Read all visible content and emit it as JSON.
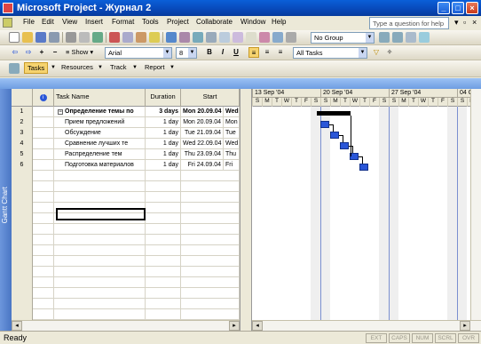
{
  "window": {
    "title": "Microsoft Project - Журнал 2"
  },
  "menu": {
    "items": [
      "File",
      "Edit",
      "View",
      "Insert",
      "Format",
      "Tools",
      "Project",
      "Collaborate",
      "Window",
      "Help"
    ],
    "help_placeholder": "Type a question for help"
  },
  "toolbar1": {
    "show_label": "Show",
    "group_value": "No Group"
  },
  "toolbar2": {
    "font": "Arial",
    "size": "8",
    "filter": "All Tasks",
    "bold": "B",
    "italic": "I",
    "underline": "U"
  },
  "guide": {
    "tasks": "Tasks",
    "resources": "Resources",
    "track": "Track",
    "report": "Report"
  },
  "sidebar": {
    "label": "Gantt Chart"
  },
  "table": {
    "headers": {
      "task_name": "Task Name",
      "duration": "Duration",
      "start": "Start"
    },
    "rows": [
      {
        "id": "1",
        "name": "Определение темы по",
        "duration": "3 days",
        "start": "Mon 20.09.04",
        "extra": "Wed",
        "bold": true
      },
      {
        "id": "2",
        "name": "Прием предложений",
        "duration": "1 day",
        "start": "Mon 20.09.04",
        "extra": "Mon"
      },
      {
        "id": "3",
        "name": "Обсуждение",
        "duration": "1 day",
        "start": "Tue 21.09.04",
        "extra": "Tue"
      },
      {
        "id": "4",
        "name": "Сравнение лучших те",
        "duration": "1 day",
        "start": "Wed 22.09.04",
        "extra": "Wed"
      },
      {
        "id": "5",
        "name": "Распределение тем",
        "duration": "1 day",
        "start": "Thu 23.09.04",
        "extra": "Thu"
      },
      {
        "id": "6",
        "name": "Подготовка материалов",
        "duration": "1 day",
        "start": "Fri 24.09.04",
        "extra": "Fri"
      }
    ]
  },
  "gantt": {
    "weeks": [
      "13 Sep '04",
      "20 Sep '04",
      "27 Sep '04",
      "04 O"
    ],
    "days": [
      "S",
      "M",
      "T",
      "W",
      "T",
      "F",
      "S",
      "S",
      "M",
      "T",
      "W",
      "T",
      "F",
      "S",
      "S",
      "M",
      "T",
      "W",
      "T",
      "F",
      "S",
      "S",
      "M",
      "T"
    ]
  },
  "status": {
    "text": "Ready",
    "indicators": [
      "EXT",
      "CAPS",
      "NUM",
      "SCRL",
      "OVR"
    ]
  }
}
